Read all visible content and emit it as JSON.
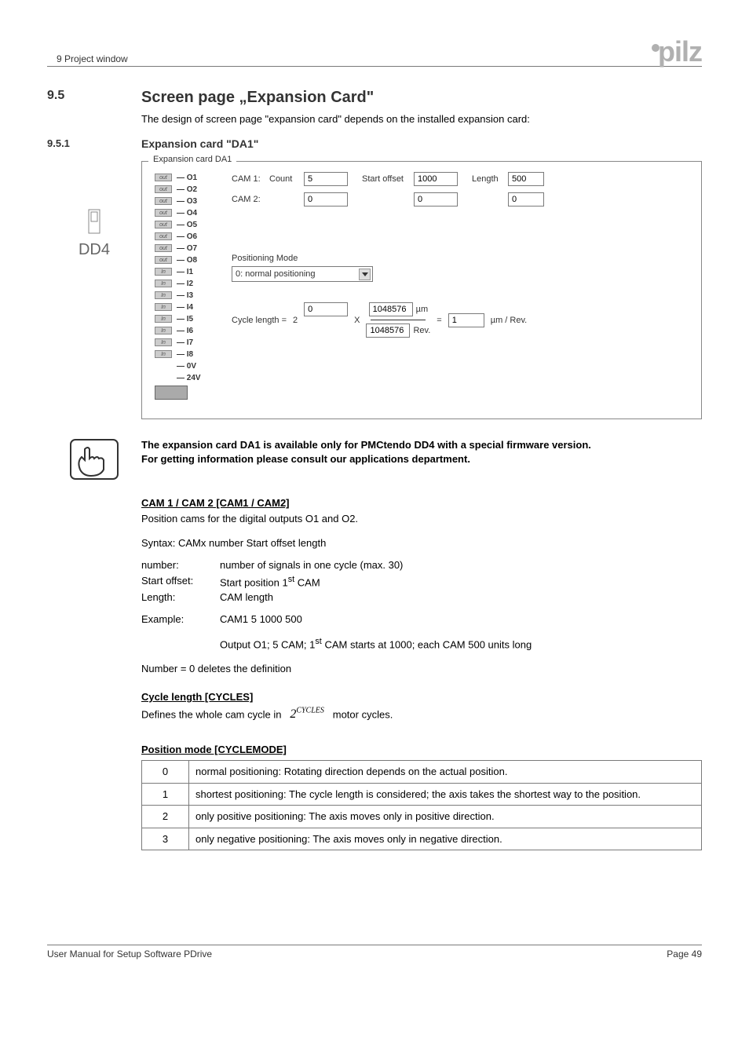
{
  "header": {
    "breadcrumb": "9  Project window",
    "logo_text": "pilz"
  },
  "section": {
    "num": "9.5",
    "title": "Screen page „Expansion Card\"",
    "intro": "The design of screen page \"expansion card\" depends on the installed expansion card:"
  },
  "subsection": {
    "num": "9.5.1",
    "title": "Expansion card \"DA1\""
  },
  "left_label": "DD4",
  "screenshot": {
    "groupbox": "Expansion card DA1",
    "io_rows": [
      {
        "type": "out",
        "label": "O1"
      },
      {
        "type": "out",
        "label": "O2"
      },
      {
        "type": "out",
        "label": "O3"
      },
      {
        "type": "out",
        "label": "O4"
      },
      {
        "type": "out",
        "label": "O5"
      },
      {
        "type": "out",
        "label": "O6"
      },
      {
        "type": "out",
        "label": "O7"
      },
      {
        "type": "out",
        "label": "O8"
      },
      {
        "type": "In",
        "label": "I1"
      },
      {
        "type": "In",
        "label": "I2"
      },
      {
        "type": "In",
        "label": "I3"
      },
      {
        "type": "In",
        "label": "I4"
      },
      {
        "type": "In",
        "label": "I5"
      },
      {
        "type": "In",
        "label": "I6"
      },
      {
        "type": "In",
        "label": "I7"
      },
      {
        "type": "In",
        "label": "I8"
      },
      {
        "type": "",
        "label": "0V"
      },
      {
        "type": "",
        "label": "24V"
      }
    ],
    "cam_labels": {
      "cam1": "CAM 1:",
      "cam2": "CAM 2:",
      "count": "Count",
      "start": "Start offset",
      "length": "Length"
    },
    "cam1": {
      "count": "5",
      "start": "1000",
      "length": "500"
    },
    "cam2": {
      "count": "0",
      "start": "0",
      "length": "0"
    },
    "posmode": {
      "label": "Positioning Mode",
      "value": "0: normal positioning"
    },
    "cycle": {
      "label": "Cycle length =",
      "exp": "2",
      "x": "X",
      "top_val": "1048576",
      "top_unit": "µm",
      "bot_val": "1048576",
      "bot_unit": "Rev.",
      "eq": "=",
      "result": "1",
      "result_unit": "µm / Rev.",
      "exp_input": "0"
    }
  },
  "note": {
    "line1": "The expansion card DA1 is available only for PMCtendo DD4 with a special firmware version.",
    "line2": "For getting information please consult our applications department."
  },
  "cam_section": {
    "head": "CAM 1 / CAM 2 [CAM1 / CAM2]",
    "sub": "Position cams for the digital outputs O1 and O2.",
    "syntax": "Syntax:  CAMx number Start offset length",
    "params": {
      "number_k": "number:",
      "number_v": "number of signals in one cycle (max. 30)",
      "start_k": "Start offset:",
      "start_v": "Start position 1",
      "start_v_suffix": " CAM",
      "length_k": "Length:",
      "length_v": "CAM length",
      "example_k": "Example:",
      "example_v": "CAM1 5 1000 500",
      "example_desc": "Output O1; 5 CAM; 1",
      "example_desc_suffix": "  CAM starts at 1000; each CAM 500 units long"
    },
    "delete_note": "Number = 0  deletes the definition"
  },
  "cycle_section": {
    "head": "Cycle length [CYCLES]",
    "text_a": "Defines the whole cam cycle in",
    "text_b": "motor cycles."
  },
  "posmode_section": {
    "head": "Position mode [CYCLEMODE]",
    "rows": [
      {
        "n": "0",
        "t": "normal positioning: Rotating direction depends on the actual position."
      },
      {
        "n": "1",
        "t": "shortest positioning: The cycle length is considered; the axis takes the shortest way to the position."
      },
      {
        "n": "2",
        "t": "only positive positioning: The axis moves only in positive direction."
      },
      {
        "n": "3",
        "t": "only negative positioning: The axis moves only in negative direction."
      }
    ]
  },
  "footer": {
    "left": "User Manual for Setup Software PDrive",
    "right": "Page 49"
  }
}
